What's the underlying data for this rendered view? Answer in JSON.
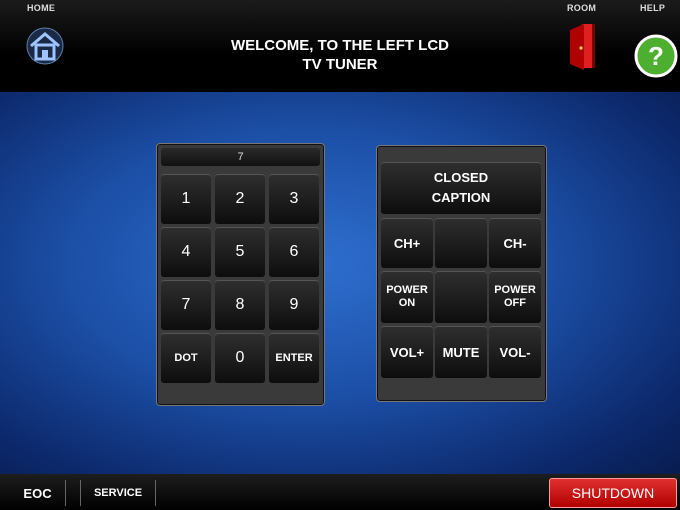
{
  "header": {
    "home_label": "HOME",
    "room_label": "ROOM",
    "help_label": "HELP",
    "title_line1": "WELCOME, TO THE LEFT LCD",
    "title_line2": "TV TUNER"
  },
  "keypad": {
    "display_value": "7",
    "keys": [
      "1",
      "2",
      "3",
      "4",
      "5",
      "6",
      "7",
      "8",
      "9",
      "DOT",
      "0",
      "ENTER"
    ]
  },
  "tv_controls": {
    "closed_caption": "CLOSED CAPTION",
    "ch_up": "CH+",
    "ch_down": "CH-",
    "power_on": "POWER ON",
    "power_off": "POWER OFF",
    "vol_up": "VOL+",
    "mute": "MUTE",
    "vol_down": "VOL-"
  },
  "footer": {
    "eoc": "EOC",
    "service": "SERVICE",
    "shutdown": "SHUTDOWN"
  },
  "colors": {
    "shutdown": "#cc1111",
    "help": "#3da12a",
    "background_blue": "#1c4fa6"
  }
}
